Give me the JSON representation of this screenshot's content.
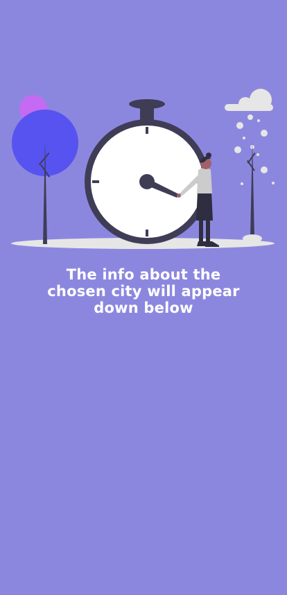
{
  "colors": {
    "background": "#8c87de",
    "text": "#ffffff",
    "tree_crown": "#5753f0",
    "sun": "#c56af2",
    "dark": "#3f3d56",
    "ground": "#e6e6e6"
  },
  "illustration": {
    "icon": "clock-with-woman-illustration"
  },
  "message": {
    "line1": "The info about the",
    "line2": "chosen city will appear",
    "line3": "down below"
  }
}
